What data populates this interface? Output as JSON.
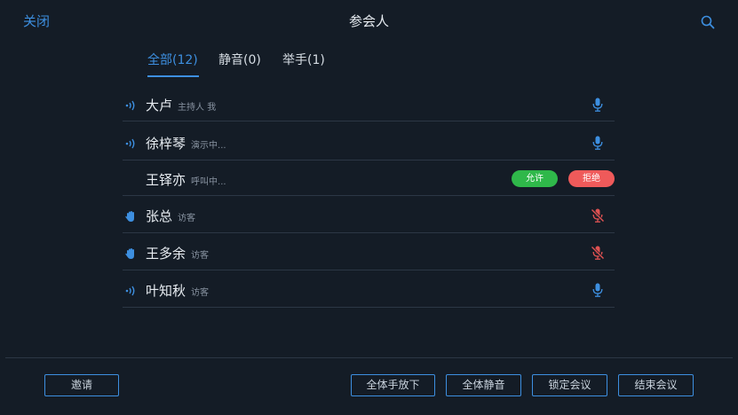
{
  "header": {
    "close_label": "关闭",
    "title": "参会人",
    "search_icon": "search-icon"
  },
  "tabs": [
    {
      "label": "全部(12)",
      "active": true
    },
    {
      "label": "静音(0)",
      "active": false
    },
    {
      "label": "举手(1)",
      "active": false
    }
  ],
  "participants": [
    {
      "name": "大卢",
      "tag": "主持人 我",
      "state": "speaking",
      "mic": "on"
    },
    {
      "name": "徐梓琴",
      "tag": "演示中...",
      "state": "speaking",
      "mic": "on"
    },
    {
      "name": "王铎亦",
      "tag": "呼叫中...",
      "state": "calling",
      "allow_label": "允许",
      "reject_label": "拒绝"
    },
    {
      "name": "张总",
      "tag": "访客",
      "state": "hand-raised",
      "mic": "muted"
    },
    {
      "name": "王多余",
      "tag": "访客",
      "state": "hand-raised",
      "mic": "muted"
    },
    {
      "name": "叶知秋",
      "tag": "访客",
      "state": "speaking",
      "mic": "on"
    }
  ],
  "footer": {
    "invite_label": "邀请",
    "lower_hands_label": "全体手放下",
    "mute_all_label": "全体静音",
    "lock_label": "锁定会议",
    "end_label": "结束会议"
  },
  "colors": {
    "accent": "#3d8fe0",
    "allow": "#2fb84a",
    "reject": "#ef5a5a",
    "muted": "#e05252",
    "background": "#141c26"
  }
}
